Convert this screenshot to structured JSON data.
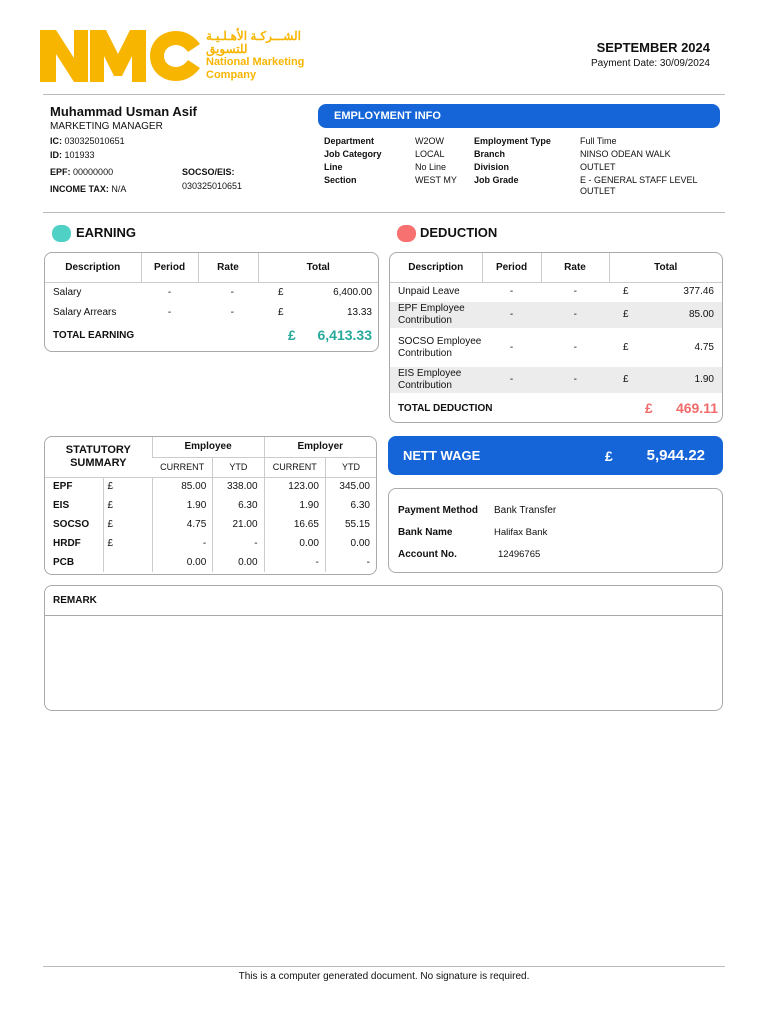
{
  "company": {
    "name_ar_1": "الشـــركـة الأهـلـيـة",
    "name_ar_2": "للتسويق",
    "name_en_1": "National Marketing",
    "name_en_2": "Company",
    "logo_text": "NMC",
    "brand_color": "#f7b500"
  },
  "period": {
    "month": "SEPTEMBER 2024",
    "payment_date": "Payment Date: 30/09/2024"
  },
  "employee": {
    "name": "Muhammad Usman Asif",
    "title": "MARKETING MANAGER",
    "ic_label": "IC:",
    "ic": "030325010651",
    "id_label": "ID:",
    "id": "101933",
    "epf_label": "EPF:",
    "epf": "00000000",
    "socso_label": "SOCSO/EIS:",
    "socso": "030325010651",
    "tax_label": "INCOME TAX:",
    "tax": "N/A"
  },
  "employment_info": {
    "title": "EMPLOYMENT INFO",
    "rows": [
      {
        "k1": "Department",
        "v1": "W2OW",
        "k2": "Employment Type",
        "v2": "Full Time"
      },
      {
        "k1": "Job Category",
        "v1": "LOCAL",
        "k2": "Branch",
        "v2": "NINSO ODEAN WALK"
      },
      {
        "k1": "Line",
        "v1": "No Line",
        "k2": "Division",
        "v2": "OUTLET"
      },
      {
        "k1": "Section",
        "v1": "WEST MY",
        "k2": "Job Grade",
        "v2": "E - GENERAL STAFF LEVEL OUTLET"
      }
    ]
  },
  "earning": {
    "title": "EARNING",
    "headers": [
      "Description",
      "Period",
      "Rate",
      "Total"
    ],
    "rows": [
      {
        "desc": "Salary",
        "period": "-",
        "rate": "-",
        "cur": "£",
        "total": "6,400.00"
      },
      {
        "desc": "Salary Arrears",
        "period": "-",
        "rate": "-",
        "cur": "£",
        "total": "13.33"
      }
    ],
    "total_label": "TOTAL EARNING",
    "total_cur": "£",
    "total": "6,413.33",
    "color": "#27a99b"
  },
  "deduction": {
    "title": "DEDUCTION",
    "headers": [
      "Description",
      "Period",
      "Rate",
      "Total"
    ],
    "rows": [
      {
        "desc": "Unpaid Leave",
        "period": "-",
        "rate": "-",
        "cur": "£",
        "total": "377.46"
      },
      {
        "desc": "EPF Employee Contribution",
        "period": "-",
        "rate": "-",
        "cur": "£",
        "total": "85.00"
      },
      {
        "desc": "SOCSO Employee Contribution",
        "period": "-",
        "rate": "-",
        "cur": "£",
        "total": "4.75"
      },
      {
        "desc": "EIS Employee Contribution",
        "period": "-",
        "rate": "-",
        "cur": "£",
        "total": "1.90"
      }
    ],
    "total_label": "TOTAL DEDUCTION",
    "total_cur": "£",
    "total": "469.11",
    "color": "#f26b6b"
  },
  "statutory": {
    "title": "STATUTORY SUMMARY",
    "employee": "Employee",
    "employer": "Employer",
    "current": "CURRENT",
    "ytd": "YTD",
    "rows": [
      {
        "name": "EPF",
        "cur": "£",
        "ee_cur": "85.00",
        "ee_ytd": "338.00",
        "er_cur": "123.00",
        "er_ytd": "345.00"
      },
      {
        "name": "EIS",
        "cur": "£",
        "ee_cur": "1.90",
        "ee_ytd": "6.30",
        "er_cur": "1.90",
        "er_ytd": "6.30"
      },
      {
        "name": "SOCSO",
        "cur": "£",
        "ee_cur": "4.75",
        "ee_ytd": "21.00",
        "er_cur": "16.65",
        "er_ytd": "55.15"
      },
      {
        "name": "HRDF",
        "cur": "£",
        "ee_cur": "-",
        "ee_ytd": "-",
        "er_cur": "0.00",
        "er_ytd": "0.00"
      },
      {
        "name": "PCB",
        "cur": "",
        "ee_cur": "0.00",
        "ee_ytd": "0.00",
        "er_cur": "-",
        "er_ytd": "-"
      }
    ]
  },
  "nett": {
    "label": "NETT WAGE",
    "cur": "£",
    "value": "5,944.22"
  },
  "payment": {
    "method_label": "Payment Method",
    "method": "Bank Transfer",
    "bank_label": "Bank Name",
    "bank": "Halifax Bank",
    "account_label": "Account No.",
    "account": "12496765"
  },
  "remark": {
    "title": "REMARK"
  },
  "footer": "This is a computer generated document. No signature is required."
}
